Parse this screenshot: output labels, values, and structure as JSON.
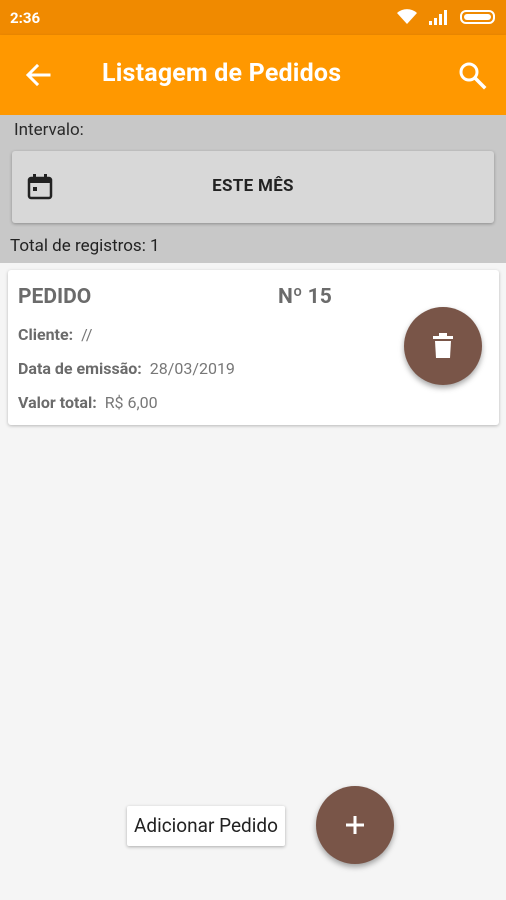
{
  "status_bar": {
    "time": "2:36",
    "icons": [
      "wifi-icon",
      "signal-icon",
      "battery-icon"
    ]
  },
  "app_bar": {
    "title": "Listagem de Pedidos",
    "back_icon": "arrow-left-icon",
    "search_icon": "search-icon",
    "color": "#ff9800"
  },
  "filter": {
    "interval_label": "Intervalo:",
    "date_button_label": "ESTE MÊS",
    "calendar_icon": "calendar-icon",
    "total_records": "Total de registros: 1"
  },
  "orders": [
    {
      "title": "PEDIDO",
      "number": "Nº 15",
      "client_label": "Cliente:",
      "client_value": "//",
      "date_label": "Data de emissão:",
      "date_value": "28/03/2019",
      "total_label": "Valor total:",
      "total_value": "R$ 6,00",
      "delete_icon": "trash-icon"
    }
  ],
  "fab": {
    "label": "Adicionar Pedido",
    "icon": "plus-icon",
    "color": "#795548"
  }
}
